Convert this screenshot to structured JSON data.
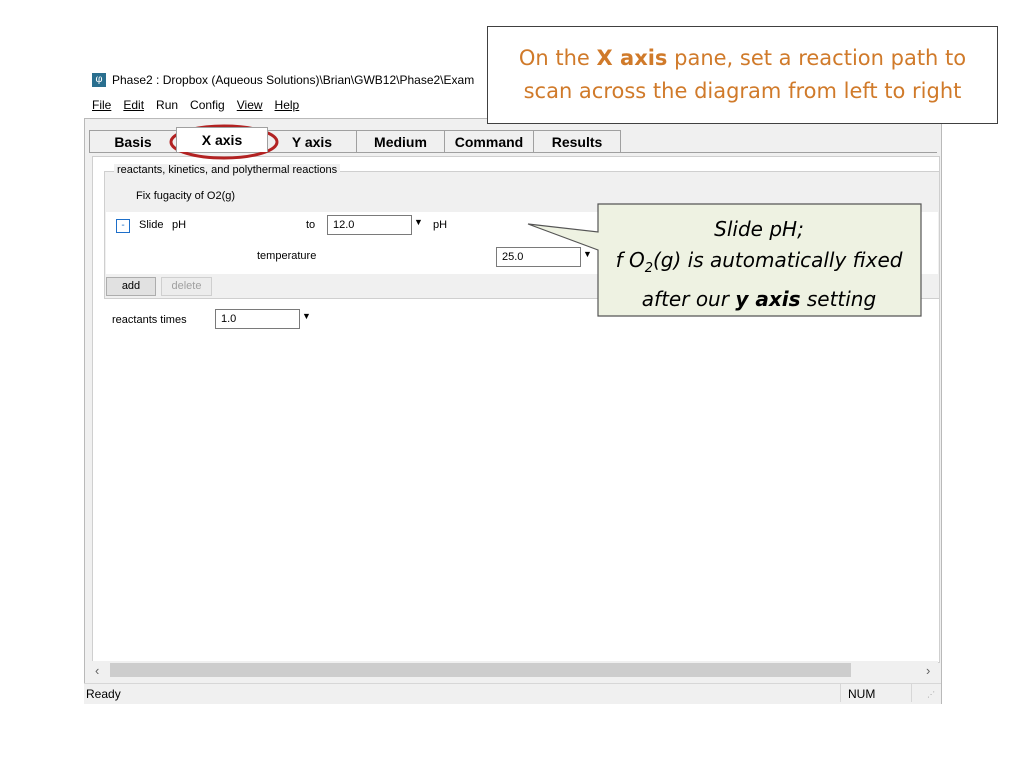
{
  "window": {
    "title": "Phase2 : Dropbox (Aqueous Solutions)\\Brian\\GWB12\\Phase2\\Exam"
  },
  "menu": [
    "File",
    "Edit",
    "Run",
    "Config",
    "View",
    "Help"
  ],
  "tabs": [
    {
      "label": "Basis"
    },
    {
      "label": "X axis",
      "active": true
    },
    {
      "label": "Y axis"
    },
    {
      "label": "Medium"
    },
    {
      "label": "Command"
    },
    {
      "label": "Results"
    }
  ],
  "pane": {
    "group_label": "reactants, kinetics, and polythermal reactions",
    "fix_fugacity": "Fix fugacity of O2(g)",
    "remove_button": "-",
    "slide_row": {
      "verb": "Slide",
      "variable": "pH",
      "to_label": "to",
      "value": "12.0",
      "unit": "pH"
    },
    "temperature_row": {
      "label": "temperature",
      "value": "25.0"
    },
    "add_button": "add",
    "delete_button": "delete",
    "reactants_times_label": "reactants times",
    "reactants_times_value": "1.0"
  },
  "status": {
    "text": "Ready",
    "num": "NUM"
  },
  "annotations": {
    "top": {
      "prefix": "On the",
      "bold": "X axis",
      "suffix": "pane, set a reaction path to",
      "line2": "scan across the diagram from left to right",
      "color": "#d07a2a"
    },
    "right": {
      "line1": "Slide pH;",
      "line2_prefix": "f O",
      "line2_sub": "2",
      "line2_suffix": "(g) is automatically fixed",
      "line3_prefix": "after our",
      "line3_bold": "y axis",
      "line3_suffix": "setting",
      "fill": "#eef2e2"
    },
    "highlight_color": "#b22222"
  },
  "icons": {
    "app": "phase2-icon",
    "dropdown": "chevron-down-icon",
    "scroll_left": "chevron-left-icon",
    "scroll_right": "chevron-right-icon",
    "resize": "resize-grip-icon"
  }
}
